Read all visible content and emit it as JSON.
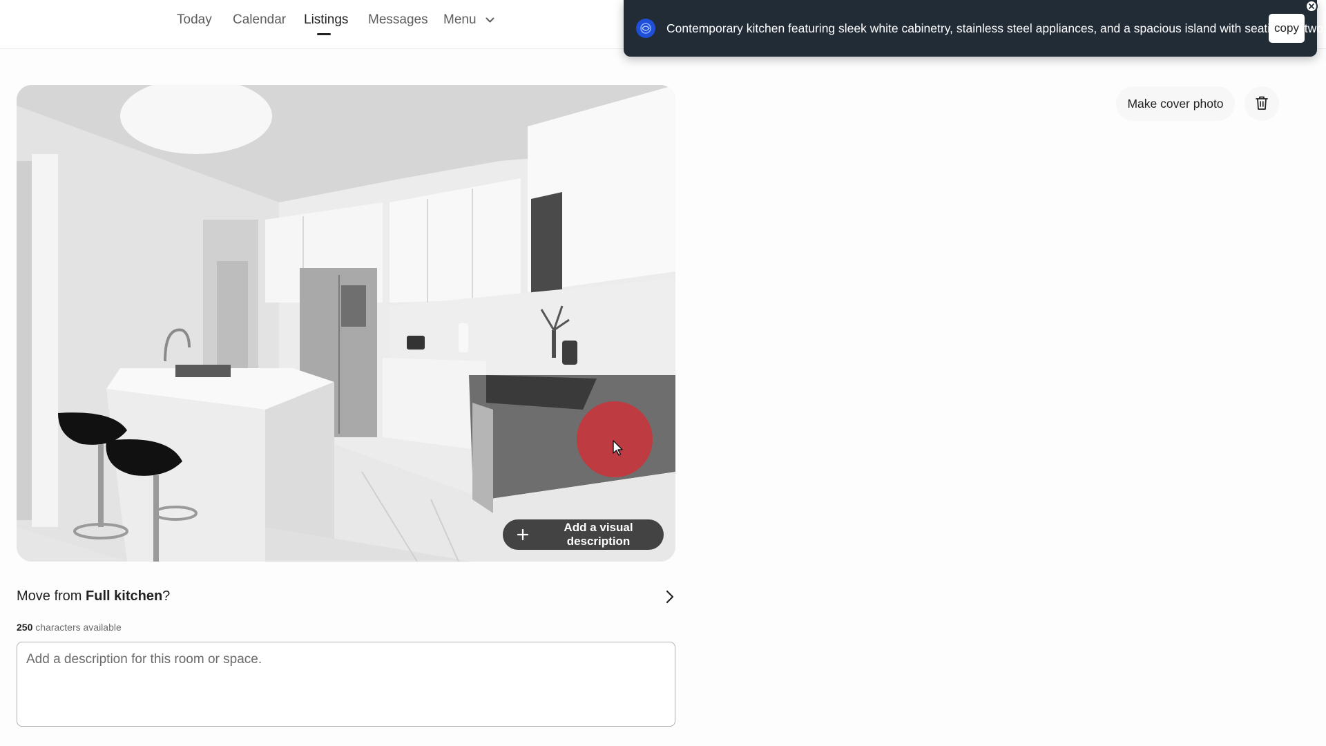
{
  "nav": {
    "items": [
      {
        "label": "Today"
      },
      {
        "label": "Calendar"
      },
      {
        "label": "Listings"
      },
      {
        "label": "Messages"
      },
      {
        "label": "Menu"
      }
    ],
    "active": "Listings"
  },
  "toast": {
    "text": "Contemporary kitchen featuring sleek white cabinetry, stainless steel appliances, and a spacious island with seating for two.",
    "copy_label": "copy"
  },
  "actions": {
    "cover_label": "Make cover photo"
  },
  "photo": {
    "add_description_label": "Add a visual description"
  },
  "move": {
    "prefix": "Move from ",
    "room": "Full kitchen",
    "suffix": "?"
  },
  "description": {
    "chars_count": "250",
    "chars_suffix": " characters available",
    "placeholder": "Add a description for this room or space.",
    "value": ""
  },
  "colors": {
    "toast_bg": "#222c37",
    "click_marker": "#de2832",
    "text_primary": "#222222"
  },
  "icons": [
    "chevron-down-icon",
    "ai-logo-icon",
    "close-icon",
    "trash-icon",
    "plus-icon",
    "chevron-right-icon",
    "cursor-icon"
  ]
}
